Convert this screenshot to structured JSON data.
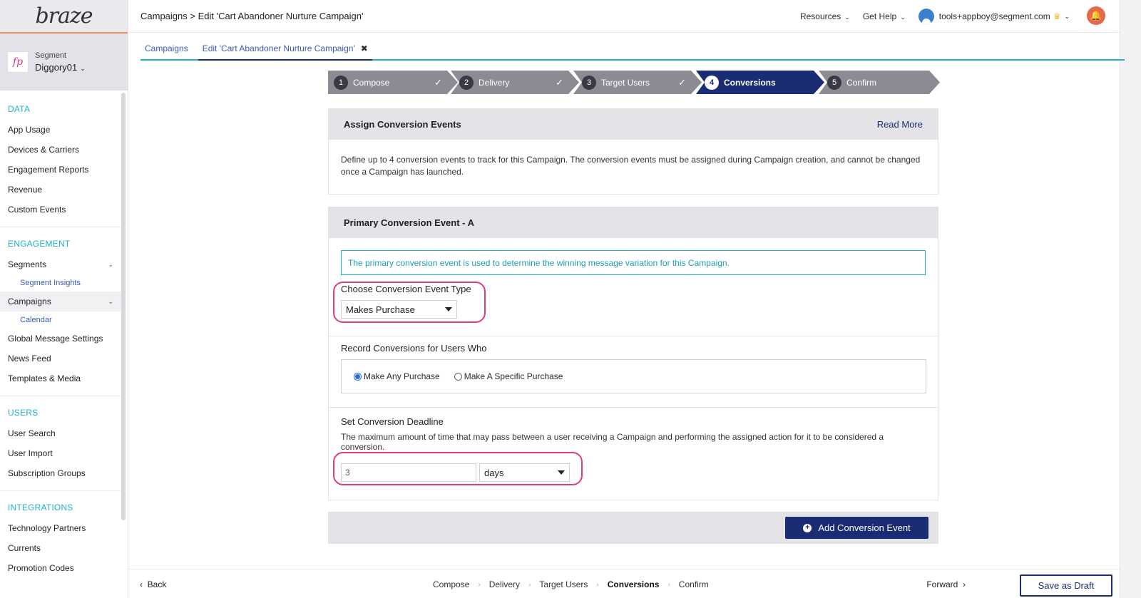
{
  "brand": {
    "logo": "braze"
  },
  "account": {
    "label": "Segment",
    "name": "Diggory01",
    "avatar_text": "fp"
  },
  "sidebar": {
    "sections": [
      {
        "heading": "DATA",
        "items": [
          "App Usage",
          "Devices & Carriers",
          "Engagement Reports",
          "Revenue",
          "Custom Events"
        ]
      },
      {
        "heading": "ENGAGEMENT",
        "items": [
          "Segments",
          "Segment Insights",
          "Campaigns",
          "Calendar",
          "Global Message Settings",
          "News Feed",
          "Templates & Media"
        ]
      },
      {
        "heading": "USERS",
        "items": [
          "User Search",
          "User Import",
          "Subscription Groups"
        ]
      },
      {
        "heading": "INTEGRATIONS",
        "items": [
          "Technology Partners",
          "Currents",
          "Promotion Codes"
        ]
      }
    ]
  },
  "header": {
    "breadcrumb": "Campaigns > Edit 'Cart Abandoner Nurture Campaign'",
    "resources": "Resources",
    "get_help": "Get Help",
    "user_email": "tools+appboy@segment.com"
  },
  "tabs": [
    "Campaigns",
    "Edit 'Cart Abandoner Nurture Campaign'"
  ],
  "steps": [
    {
      "num": "1",
      "label": "Compose"
    },
    {
      "num": "2",
      "label": "Delivery"
    },
    {
      "num": "3",
      "label": "Target Users"
    },
    {
      "num": "4",
      "label": "Conversions"
    },
    {
      "num": "5",
      "label": "Confirm"
    }
  ],
  "assign": {
    "title": "Assign Conversion Events",
    "read_more": "Read More",
    "description": "Define up to 4 conversion events to track for this Campaign. The conversion events must be assigned during Campaign creation, and cannot be changed once a Campaign has launched."
  },
  "primary": {
    "title": "Primary Conversion Event - A",
    "info": "The primary conversion event is used to determine the winning message variation for this Campaign.",
    "event_type_label": "Choose Conversion Event Type",
    "event_type_value": "Makes Purchase",
    "record_label": "Record Conversions for Users Who",
    "radio_any": "Make Any Purchase",
    "radio_specific": "Make A Specific Purchase",
    "deadline_label": "Set Conversion Deadline",
    "deadline_desc": "The maximum amount of time that may pass between a user receiving a Campaign and performing the assigned action for it to be considered a conversion.",
    "deadline_value": "3",
    "deadline_unit": "days"
  },
  "add_button": "Add Conversion Event",
  "footer": {
    "back": "Back",
    "steps": [
      "Compose",
      "Delivery",
      "Target Users",
      "Conversions",
      "Confirm"
    ],
    "forward": "Forward",
    "save": "Save as Draft"
  }
}
